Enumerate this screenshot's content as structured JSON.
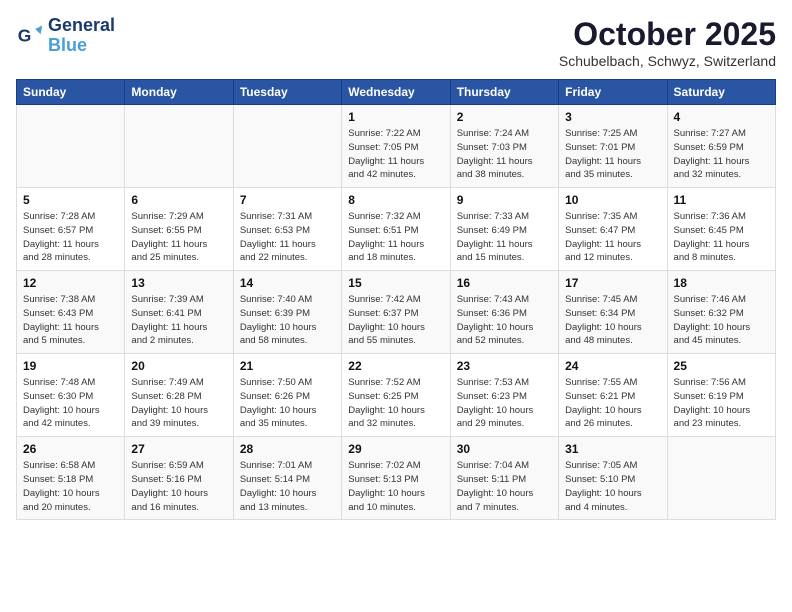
{
  "logo": {
    "line1": "General",
    "line2": "Blue"
  },
  "title": "October 2025",
  "location": "Schubelbach, Schwyz, Switzerland",
  "weekdays": [
    "Sunday",
    "Monday",
    "Tuesday",
    "Wednesday",
    "Thursday",
    "Friday",
    "Saturday"
  ],
  "weeks": [
    [
      {
        "day": "",
        "info": ""
      },
      {
        "day": "",
        "info": ""
      },
      {
        "day": "",
        "info": ""
      },
      {
        "day": "1",
        "info": "Sunrise: 7:22 AM\nSunset: 7:05 PM\nDaylight: 11 hours\nand 42 minutes."
      },
      {
        "day": "2",
        "info": "Sunrise: 7:24 AM\nSunset: 7:03 PM\nDaylight: 11 hours\nand 38 minutes."
      },
      {
        "day": "3",
        "info": "Sunrise: 7:25 AM\nSunset: 7:01 PM\nDaylight: 11 hours\nand 35 minutes."
      },
      {
        "day": "4",
        "info": "Sunrise: 7:27 AM\nSunset: 6:59 PM\nDaylight: 11 hours\nand 32 minutes."
      }
    ],
    [
      {
        "day": "5",
        "info": "Sunrise: 7:28 AM\nSunset: 6:57 PM\nDaylight: 11 hours\nand 28 minutes."
      },
      {
        "day": "6",
        "info": "Sunrise: 7:29 AM\nSunset: 6:55 PM\nDaylight: 11 hours\nand 25 minutes."
      },
      {
        "day": "7",
        "info": "Sunrise: 7:31 AM\nSunset: 6:53 PM\nDaylight: 11 hours\nand 22 minutes."
      },
      {
        "day": "8",
        "info": "Sunrise: 7:32 AM\nSunset: 6:51 PM\nDaylight: 11 hours\nand 18 minutes."
      },
      {
        "day": "9",
        "info": "Sunrise: 7:33 AM\nSunset: 6:49 PM\nDaylight: 11 hours\nand 15 minutes."
      },
      {
        "day": "10",
        "info": "Sunrise: 7:35 AM\nSunset: 6:47 PM\nDaylight: 11 hours\nand 12 minutes."
      },
      {
        "day": "11",
        "info": "Sunrise: 7:36 AM\nSunset: 6:45 PM\nDaylight: 11 hours\nand 8 minutes."
      }
    ],
    [
      {
        "day": "12",
        "info": "Sunrise: 7:38 AM\nSunset: 6:43 PM\nDaylight: 11 hours\nand 5 minutes."
      },
      {
        "day": "13",
        "info": "Sunrise: 7:39 AM\nSunset: 6:41 PM\nDaylight: 11 hours\nand 2 minutes."
      },
      {
        "day": "14",
        "info": "Sunrise: 7:40 AM\nSunset: 6:39 PM\nDaylight: 10 hours\nand 58 minutes."
      },
      {
        "day": "15",
        "info": "Sunrise: 7:42 AM\nSunset: 6:37 PM\nDaylight: 10 hours\nand 55 minutes."
      },
      {
        "day": "16",
        "info": "Sunrise: 7:43 AM\nSunset: 6:36 PM\nDaylight: 10 hours\nand 52 minutes."
      },
      {
        "day": "17",
        "info": "Sunrise: 7:45 AM\nSunset: 6:34 PM\nDaylight: 10 hours\nand 48 minutes."
      },
      {
        "day": "18",
        "info": "Sunrise: 7:46 AM\nSunset: 6:32 PM\nDaylight: 10 hours\nand 45 minutes."
      }
    ],
    [
      {
        "day": "19",
        "info": "Sunrise: 7:48 AM\nSunset: 6:30 PM\nDaylight: 10 hours\nand 42 minutes."
      },
      {
        "day": "20",
        "info": "Sunrise: 7:49 AM\nSunset: 6:28 PM\nDaylight: 10 hours\nand 39 minutes."
      },
      {
        "day": "21",
        "info": "Sunrise: 7:50 AM\nSunset: 6:26 PM\nDaylight: 10 hours\nand 35 minutes."
      },
      {
        "day": "22",
        "info": "Sunrise: 7:52 AM\nSunset: 6:25 PM\nDaylight: 10 hours\nand 32 minutes."
      },
      {
        "day": "23",
        "info": "Sunrise: 7:53 AM\nSunset: 6:23 PM\nDaylight: 10 hours\nand 29 minutes."
      },
      {
        "day": "24",
        "info": "Sunrise: 7:55 AM\nSunset: 6:21 PM\nDaylight: 10 hours\nand 26 minutes."
      },
      {
        "day": "25",
        "info": "Sunrise: 7:56 AM\nSunset: 6:19 PM\nDaylight: 10 hours\nand 23 minutes."
      }
    ],
    [
      {
        "day": "26",
        "info": "Sunrise: 6:58 AM\nSunset: 5:18 PM\nDaylight: 10 hours\nand 20 minutes."
      },
      {
        "day": "27",
        "info": "Sunrise: 6:59 AM\nSunset: 5:16 PM\nDaylight: 10 hours\nand 16 minutes."
      },
      {
        "day": "28",
        "info": "Sunrise: 7:01 AM\nSunset: 5:14 PM\nDaylight: 10 hours\nand 13 minutes."
      },
      {
        "day": "29",
        "info": "Sunrise: 7:02 AM\nSunset: 5:13 PM\nDaylight: 10 hours\nand 10 minutes."
      },
      {
        "day": "30",
        "info": "Sunrise: 7:04 AM\nSunset: 5:11 PM\nDaylight: 10 hours\nand 7 minutes."
      },
      {
        "day": "31",
        "info": "Sunrise: 7:05 AM\nSunset: 5:10 PM\nDaylight: 10 hours\nand 4 minutes."
      },
      {
        "day": "",
        "info": ""
      }
    ]
  ]
}
